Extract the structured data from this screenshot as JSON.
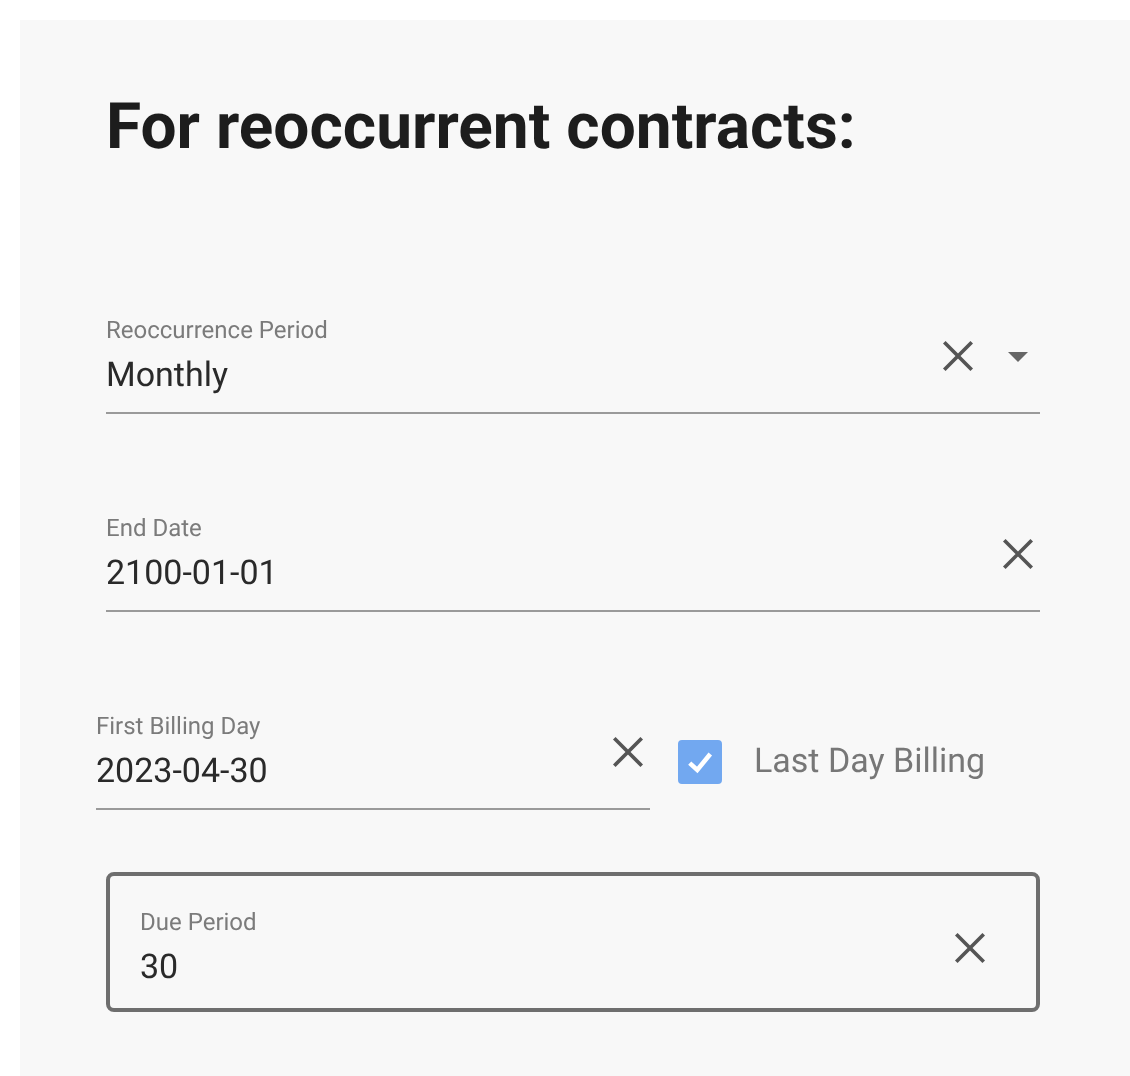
{
  "title": "For reoccurrent contracts:",
  "fields": [
    {
      "kind": "select",
      "label": "Reoccurrence Period",
      "value": "Monthly"
    },
    {
      "kind": "underline",
      "label": "End Date",
      "value": "2100-01-01"
    },
    {
      "kind": "underline",
      "label": "First Billing Day",
      "value": "2023-04-30",
      "checkbox": {
        "label": "Last Day Billing",
        "checked": true
      }
    },
    {
      "kind": "outlined",
      "label": "Due Period",
      "value": "30"
    }
  ]
}
